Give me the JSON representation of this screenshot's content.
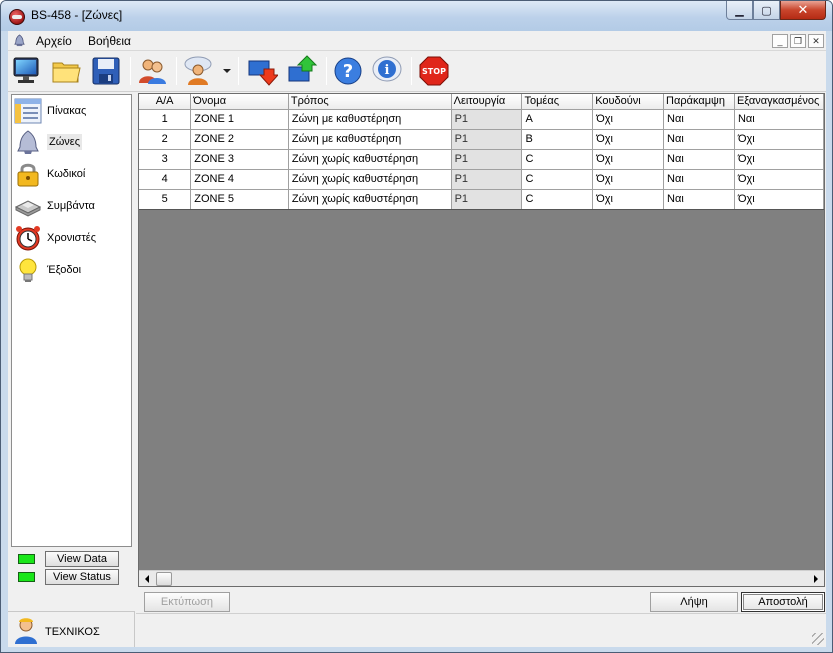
{
  "window": {
    "title": "BS-458 - [Ζώνες]"
  },
  "menu": {
    "items": [
      "Αρχείο",
      "Βοήθεια"
    ]
  },
  "toolbar": {
    "icons": [
      "monitor-icon",
      "open-folder-icon",
      "save-icon",
      "users-icon",
      "user-chat-icon",
      "download-icon",
      "upload-icon",
      "help-icon",
      "info-icon",
      "stop-icon"
    ],
    "stop_label": "STOP"
  },
  "sidebar": {
    "items": [
      {
        "label": "Πίνακας",
        "icon": "panel-icon"
      },
      {
        "label": "Ζώνες",
        "icon": "zone-bell-icon"
      },
      {
        "label": "Κωδικοί",
        "icon": "lock-icon"
      },
      {
        "label": "Συμβάντα",
        "icon": "events-icon"
      },
      {
        "label": "Χρονιστές",
        "icon": "alarm-clock-icon"
      },
      {
        "label": "Έξοδοι",
        "icon": "lightbulb-icon"
      }
    ],
    "active": "Ζώνες",
    "view_data": "View Data",
    "view_status": "View Status",
    "led_color": "#19e619"
  },
  "user": {
    "name": "ΤΕΧΝΙΚΟΣ"
  },
  "grid": {
    "columns": [
      "Α/Α",
      "Όνομα",
      "Τρόπος",
      "Λειτουργία",
      "Τομέας",
      "Κουδούνι",
      "Παράκαμψη",
      "Εξαναγκασμένος"
    ],
    "rows": [
      [
        "1",
        "ZONE 1",
        "Ζώνη με καθυστέρηση",
        "P1",
        "A",
        "Όχι",
        "Ναι",
        "Ναι"
      ],
      [
        "2",
        "ZONE 2",
        "Ζώνη με καθυστέρηση",
        "P1",
        "B",
        "Όχι",
        "Ναι",
        "Όχι"
      ],
      [
        "3",
        "ZONE 3",
        "Ζώνη χωρίς καθυστέρηση",
        "P1",
        "C",
        "Όχι",
        "Ναι",
        "Όχι"
      ],
      [
        "4",
        "ZONE 4",
        "Ζώνη χωρίς καθυστέρηση",
        "P1",
        "C",
        "Όχι",
        "Ναι",
        "Όχι"
      ],
      [
        "5",
        "ZONE 5",
        "Ζώνη χωρίς καθυστέρηση",
        "P1",
        "C",
        "Όχι",
        "Ναι",
        "Όχι"
      ]
    ]
  },
  "actions": {
    "print": "Εκτύπωση",
    "receive": "Λήψη",
    "send": "Αποστολή"
  }
}
